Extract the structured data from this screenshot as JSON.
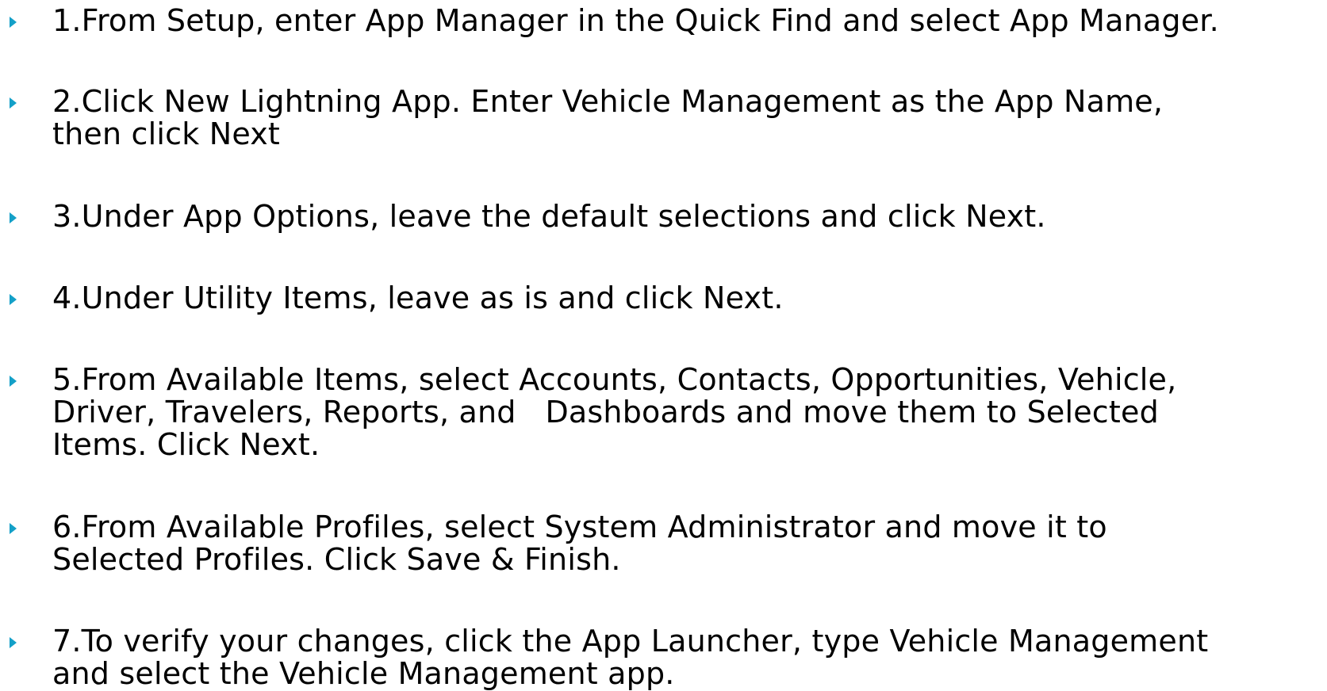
{
  "slide": {
    "bullet_color": "#14a0c8",
    "steps": [
      {
        "text": "1.From Setup, enter App Manager in the Quick Find and select App Manager."
      },
      {
        "text": "2.Click New Lightning App. Enter Vehicle Management as the App Name,\nthen click Next"
      },
      {
        "text": "3.Under App Options, leave the default selections and click Next."
      },
      {
        "text": "4.Under Utility Items, leave as is and click Next."
      },
      {
        "text": "5.From Available Items, select Accounts, Contacts, Opportunities, Vehicle,\nDriver, Travelers, Reports, and   Dashboards and move them to Selected\nItems. Click Next."
      },
      {
        "text": "6.From Available Profiles, select System Administrator and move it to\nSelected Profiles. Click Save & Finish."
      },
      {
        "text": "7.To verify your changes, click the App Launcher, type Vehicle Management\nand select the Vehicle Management app."
      }
    ]
  }
}
